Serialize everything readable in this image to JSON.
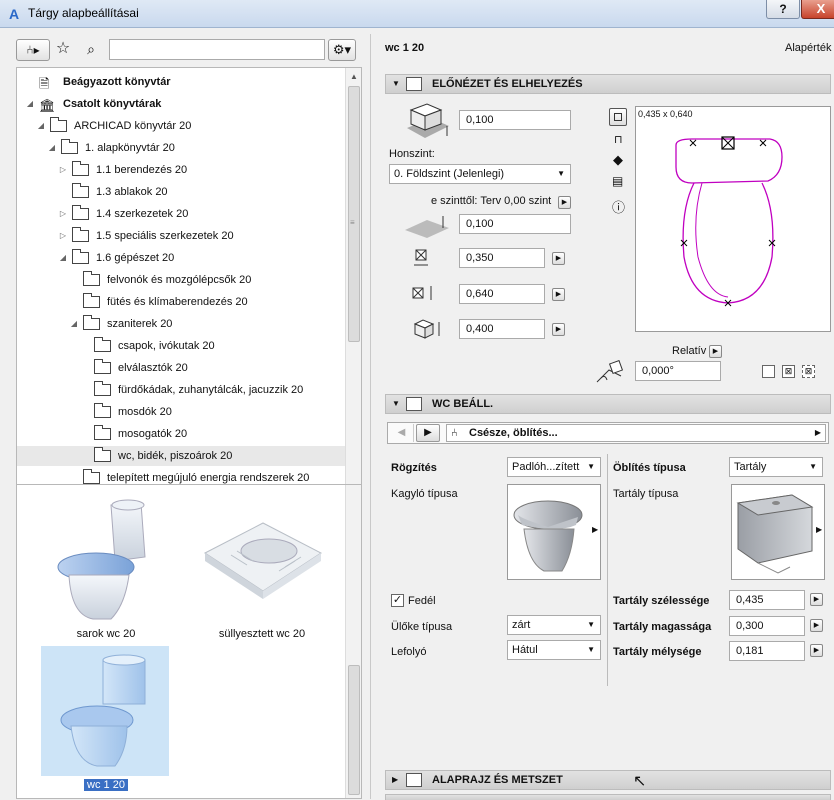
{
  "window": {
    "title": "Tárgy alapbeállításai",
    "help_label": "?",
    "close_label": "X"
  },
  "left": {
    "search_placeholder": "",
    "tree": [
      {
        "label": "Beágyazott könyvtár",
        "bold": true
      },
      {
        "label": "Csatolt könyvtárak",
        "bold": true
      },
      {
        "label": "ARCHICAD könyvtár 20"
      },
      {
        "label": "1. alapkönyvtár 20"
      },
      {
        "label": "1.1 berendezés 20"
      },
      {
        "label": "1.3 ablakok 20"
      },
      {
        "label": "1.4 szerkezetek 20"
      },
      {
        "label": "1.5 speciális szerkezetek 20"
      },
      {
        "label": "1.6 gépészet 20"
      },
      {
        "label": "felvonók és mozgólépcsők 20"
      },
      {
        "label": "fütés és klímaberendezés 20"
      },
      {
        "label": "szaniterek 20"
      },
      {
        "label": "csapok, ivókutak 20"
      },
      {
        "label": "elválasztók 20"
      },
      {
        "label": "fürdőkádak, zuhanytálcák, jacuzzik 20"
      },
      {
        "label": "mosdók 20"
      },
      {
        "label": "mosogatók 20"
      },
      {
        "label": "wc, bidék, piszoárok 20"
      },
      {
        "label": "telepített megújuló energia rendszerek 20"
      }
    ],
    "gallery": [
      {
        "caption": "sarok wc 20"
      },
      {
        "caption": "süllyesztett wc 20"
      },
      {
        "caption": "wc 1 20",
        "selected": true
      }
    ]
  },
  "right": {
    "object_name": "wc 1 20",
    "defaults_label": "Alapérték",
    "preview_section": {
      "title": "ELŐNÉZET ÉS ELHELYEZÉS",
      "height_value": "0,100",
      "story_label": "Honszint:",
      "story_value": "0. Földszint (Jelenlegi)",
      "offset_label": "e szinttől: Terv 0,00 szint",
      "offset_value": "0,100",
      "width_value": "0,350",
      "depth_value": "0,640",
      "elevation_value": "0,400",
      "preview_size": "0,435 x 0,640",
      "relative_label": "Relatív",
      "angle_value": "0,000°"
    },
    "wc_section": {
      "title": "WC BEÁLL.",
      "page_label": "Csésze, öblítés...",
      "left": {
        "fixing_label": "Rögzítés",
        "fixing_value": "Padlóh...zített",
        "bowl_label": "Kagyló típusa",
        "lid_label": "Fedél",
        "lid_checked": true,
        "seat_label": "Ülőke típusa",
        "seat_value": "zárt",
        "drain_label": "Lefolyó",
        "drain_value": "Hátul"
      },
      "right": {
        "flush_label": "Öblítés típusa",
        "flush_value": "Tartály",
        "tank_label": "Tartály típusa",
        "tank_width_label": "Tartály szélessége",
        "tank_width_value": "0,435",
        "tank_height_label": "Tartály magassága",
        "tank_height_value": "0,300",
        "tank_depth_label": "Tartály mélysége",
        "tank_depth_value": "0,181"
      }
    },
    "plan_section": {
      "title": "ALAPRAJZ ÉS METSZET"
    }
  },
  "colors": {
    "accent": "#c000c0",
    "selection": "#cde4f7",
    "caption_selected": "#3a6fc4"
  }
}
